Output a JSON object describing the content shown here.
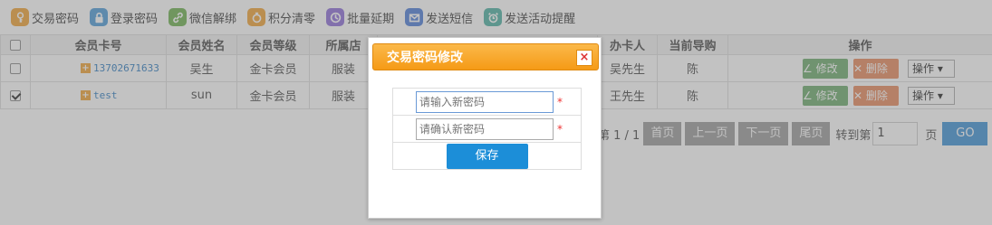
{
  "toolbar": {
    "items": [
      {
        "label": "交易密码",
        "icon": "key-icon",
        "color": "#f0a030"
      },
      {
        "label": "登录密码",
        "icon": "lock-icon",
        "color": "#4a9ad8"
      },
      {
        "label": "微信解绑",
        "icon": "link-icon",
        "color": "#6ab04c"
      },
      {
        "label": "积分清零",
        "icon": "coins-icon",
        "color": "#f0a030"
      },
      {
        "label": "批量延期",
        "icon": "clock-icon",
        "color": "#8a6ad8"
      },
      {
        "label": "发送短信",
        "icon": "mail-icon",
        "color": "#4a7ad8"
      },
      {
        "label": "发送活动提醒",
        "icon": "alarm-icon",
        "color": "#4ab0a0"
      }
    ]
  },
  "table": {
    "headers": [
      "会员卡号",
      "会员姓名",
      "会员等级",
      "所属店",
      "办卡人",
      "当前导购",
      "操作"
    ],
    "rows": [
      {
        "checked": false,
        "card": "13702671633",
        "name": "吴生",
        "level": "金卡会员",
        "store": "服装",
        "agent": "吴先生",
        "guide": "陈"
      },
      {
        "checked": true,
        "card": "test",
        "name": "sun",
        "level": "金卡会员",
        "store": "服装",
        "agent": "王先生",
        "guide": "陈"
      }
    ],
    "edit_label": "∠ 修改",
    "delete_label": "✕ 删除",
    "op_select": "操作 ▾"
  },
  "pager": {
    "info": "第 1 / 1",
    "first": "首页",
    "prev": "上一页",
    "next": "下一页",
    "last": "尾页",
    "goto_label": "转到第",
    "page_value": "1",
    "page_suffix": "页",
    "go": "GO"
  },
  "modal": {
    "title": "交易密码修改",
    "close": "×",
    "new_placeholder": "请输入新密码",
    "confirm_placeholder": "请确认新密码",
    "required": "*",
    "save": "保存"
  }
}
